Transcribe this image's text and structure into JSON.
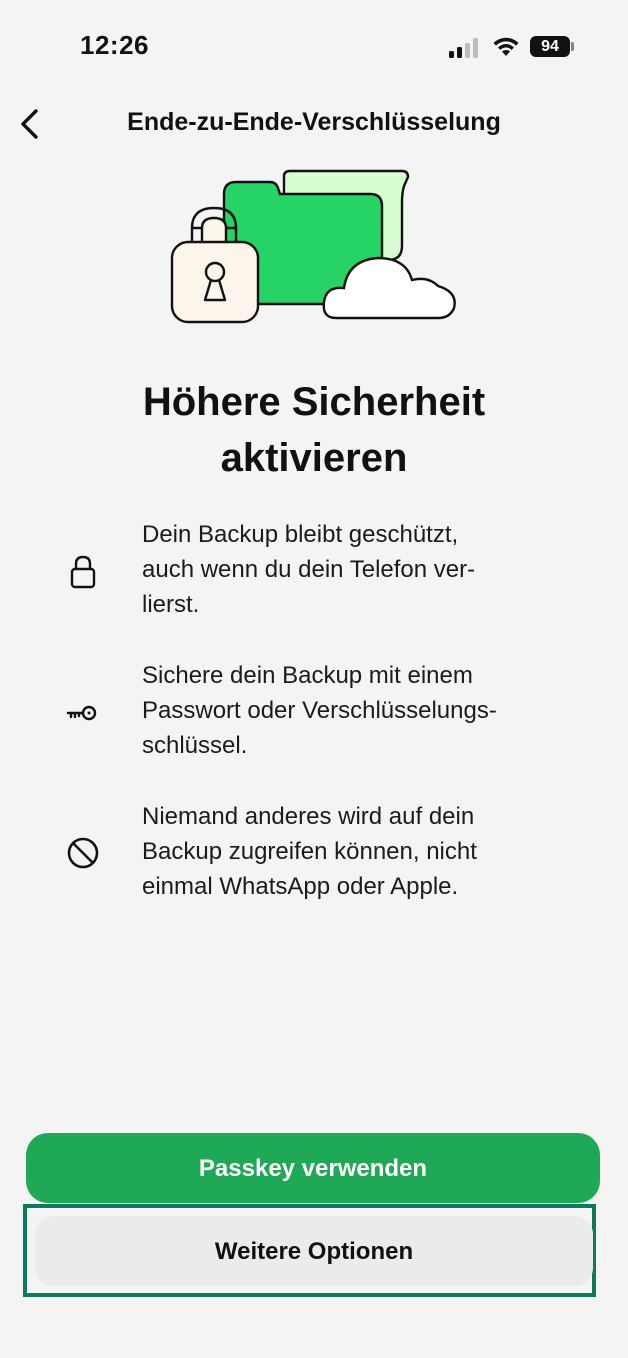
{
  "status_bar": {
    "time": "12:26",
    "battery": "94"
  },
  "nav": {
    "title": "Ende-zu-Ende-Verschlüsselung",
    "back_icon": "chevron-left-icon"
  },
  "illustration": {
    "icon": "encrypted-backup-illustration",
    "colors": {
      "folder": "#25d366",
      "folder_back": "#d9fdd3",
      "lock": "#fcf5eb",
      "cloud": "#ffffff"
    }
  },
  "headline": {
    "line1": "Höhere Sicherheit",
    "line2": "aktivieren"
  },
  "features": [
    {
      "icon": "lock-icon",
      "lines": [
        "Dein Backup bleibt geschützt,",
        "auch wenn du dein Telefon ver-",
        "lierst."
      ]
    },
    {
      "icon": "key-icon",
      "lines": [
        "Sichere dein Backup mit einem",
        "Passwort oder Verschlüsselungs-",
        "schlüssel."
      ]
    },
    {
      "icon": "prohibited-icon",
      "lines": [
        "Niemand anderes wird auf dein",
        "Backup zugreifen können, nicht",
        "einmal WhatsApp oder Apple."
      ]
    }
  ],
  "buttons": {
    "primary": "Passkey verwenden",
    "secondary": "Weitere Optionen"
  },
  "colors": {
    "primary_button": "#1fa855",
    "highlight_frame": "#0e7a5c",
    "background": "#f4f4f4"
  }
}
